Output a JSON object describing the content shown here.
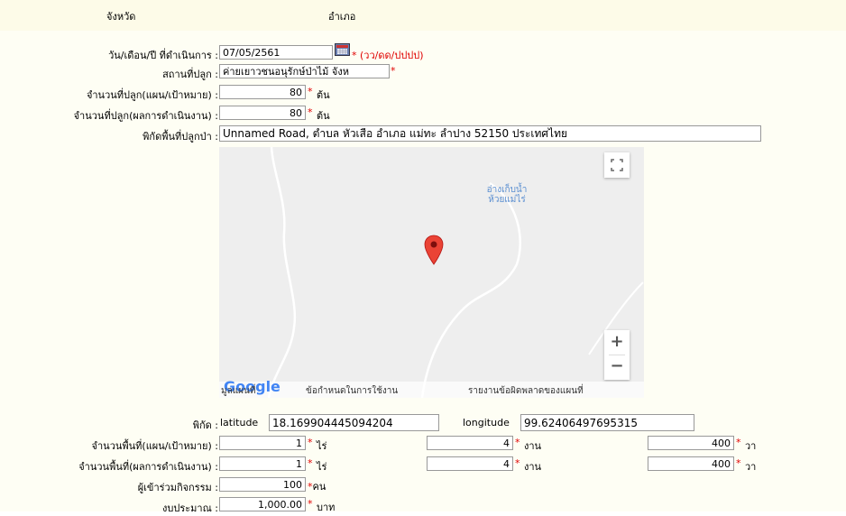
{
  "header": {
    "province": "จังหวัด",
    "district": "อำเภอ"
  },
  "date": {
    "label": "วัน/เดือน/ปี ที่ดำเนินการ :",
    "value": "07/05/2561",
    "hint": "* (วว/ดด/ปปปป)"
  },
  "place": {
    "label": "สถานที่ปลูก :",
    "value": "ค่ายเยาวชนอนุรักษ์ป่าไม้ จังห",
    "req": "*"
  },
  "plant_target": {
    "label": "จำนวนที่ปลูก(แผน/เป้าหมาย) :",
    "value": "80",
    "req": "*",
    "unit": "ต้น"
  },
  "plant_result": {
    "label": "จำนวนที่ปลูก(ผลการดำเนินงาน) :",
    "value": "80",
    "req": "*",
    "unit": "ต้น"
  },
  "location": {
    "label": "พิกัดพื้นที่ปลูกป่า :",
    "value": "Unnamed Road, ตำบล หัวเสือ อำเภอ แม่ทะ ลำปาง 52150 ประเทศไทย"
  },
  "map": {
    "place_label_1": "อ่างเก็บน้ำ",
    "place_label_2": "ห้วยแม่ไร่",
    "zoom_in": "+",
    "zoom_out": "−",
    "google": "Google",
    "map_data": "มูลแผนที่",
    "terms": "ข้อกำหนดในการใช้งาน",
    "report": "รายงานข้อผิดพลาดของแผนที่"
  },
  "coords": {
    "label": "พิกัด :",
    "lat_label": "latitude",
    "lat_value": "18.169904445094204",
    "lng_label": "longitude",
    "lng_value": "99.62406497695315"
  },
  "area_target": {
    "label": "จำนวนพื้นที่(แผน/เป้าหมาย) :",
    "rai": "1",
    "ngan": "4",
    "wa": "400"
  },
  "area_result": {
    "label": "จำนวนพื้นที่(ผลการดำเนินงาน) :",
    "rai": "1",
    "ngan": "4",
    "wa": "400"
  },
  "units": {
    "rai": "ไร่",
    "ngan": "งาน",
    "wa": "วา",
    "req": "*"
  },
  "participants": {
    "label": "ผู้เข้าร่วมกิจกรรม :",
    "value": "100",
    "unit": "*คน"
  },
  "budget": {
    "label": "งบประมาณ :",
    "value": "1,000.00",
    "req": "*",
    "unit": "บาท"
  },
  "colors": {
    "header_bg": "#fdfbe8",
    "required": "#e00000",
    "pin": "#ea4335"
  }
}
